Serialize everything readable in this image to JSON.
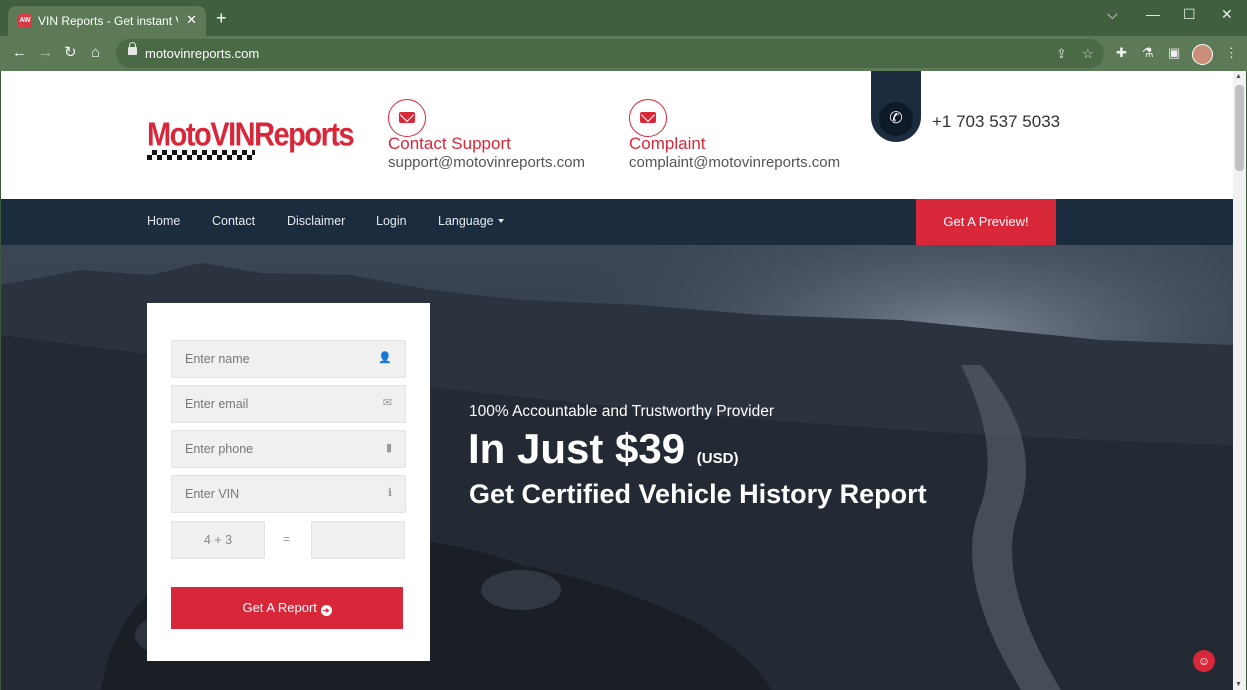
{
  "browser": {
    "tab_title": "VIN Reports - Get instant VIN re",
    "tab_favicon": "AW",
    "url": "motovinreports.com"
  },
  "header": {
    "logo": "MotoVINReports",
    "support": {
      "title": "Contact Support",
      "email": "support@motovinreports.com"
    },
    "complaint": {
      "title": "Complaint",
      "email": "complaint@motovinreports.com"
    },
    "phone": "+1 703 537 5033"
  },
  "nav": {
    "items": [
      "Home",
      "Contact",
      "Disclaimer",
      "Login",
      "Language"
    ],
    "cta": "Get A Preview!"
  },
  "form": {
    "name_placeholder": "Enter name",
    "email_placeholder": "Enter email",
    "phone_placeholder": "Enter phone",
    "vin_placeholder": "Enter VIN",
    "captcha_question": "4 + 3",
    "captcha_equals": "=",
    "submit_label": "Get A Report"
  },
  "hero": {
    "tagline": "100% Accountable and Trustworthy Provider",
    "price": "In Just $39",
    "currency": "(USD)",
    "headline": "Get Certified Vehicle History Report"
  },
  "colors": {
    "accent": "#d9273a",
    "navy": "#1c2c3f"
  }
}
